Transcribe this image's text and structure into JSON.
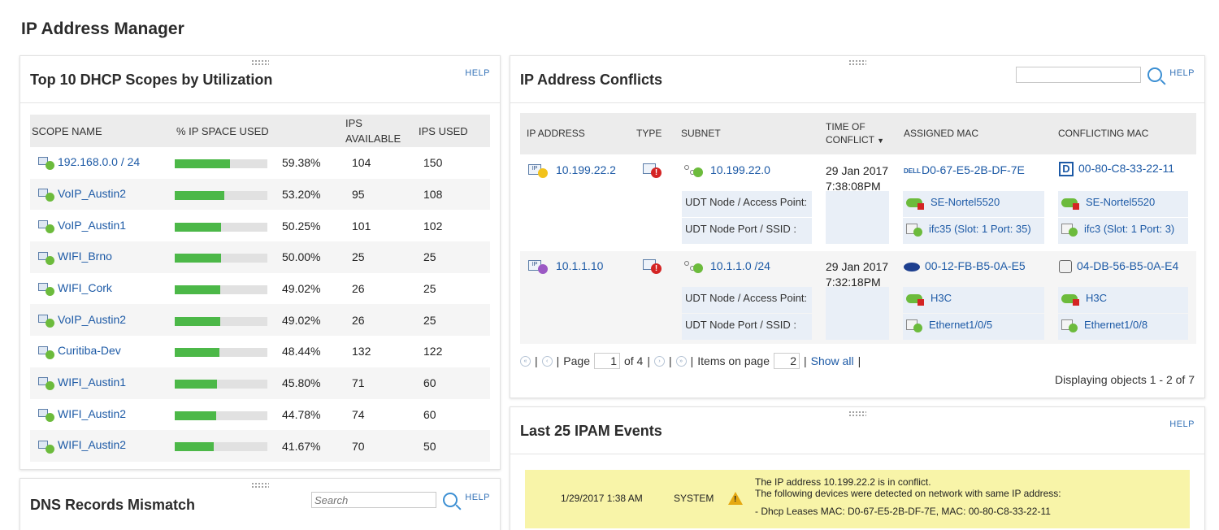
{
  "page_title": "IP Address Manager",
  "dhcp": {
    "title": "Top 10 DHCP Scopes by Utilization",
    "help": "HELP",
    "columns": {
      "scope": "SCOPE NAME",
      "used_pct": "% IP SPACE USED",
      "available": "IPS AVAILABLE",
      "used": "IPS USED"
    },
    "rows": [
      {
        "name": "192.168.0.0 / 24",
        "pct": "59.38%",
        "fill": 0.5938,
        "available": "104",
        "used": "150"
      },
      {
        "name": "VoIP_Austin2",
        "pct": "53.20%",
        "fill": 0.532,
        "available": "95",
        "used": "108"
      },
      {
        "name": "VoIP_Austin1",
        "pct": "50.25%",
        "fill": 0.5025,
        "available": "101",
        "used": "102"
      },
      {
        "name": "WIFI_Brno",
        "pct": "50.00%",
        "fill": 0.5,
        "available": "25",
        "used": "25"
      },
      {
        "name": "WIFI_Cork",
        "pct": "49.02%",
        "fill": 0.4902,
        "available": "26",
        "used": "25"
      },
      {
        "name": "VoIP_Austin2",
        "pct": "49.02%",
        "fill": 0.4902,
        "available": "26",
        "used": "25"
      },
      {
        "name": "Curitiba-Dev",
        "pct": "48.44%",
        "fill": 0.4844,
        "available": "132",
        "used": "122"
      },
      {
        "name": "WIFI_Austin1",
        "pct": "45.80%",
        "fill": 0.458,
        "available": "71",
        "used": "60"
      },
      {
        "name": "WIFI_Austin2",
        "pct": "44.78%",
        "fill": 0.4478,
        "available": "74",
        "used": "60"
      },
      {
        "name": "WIFI_Austin2",
        "pct": "41.67%",
        "fill": 0.4167,
        "available": "70",
        "used": "50"
      }
    ]
  },
  "dns": {
    "title": "DNS Records Mismatch",
    "search_placeholder": "Search",
    "help": "HELP"
  },
  "conflicts": {
    "title": "IP Address Conflicts",
    "help": "HELP",
    "columns": {
      "ip": "IP ADDRESS",
      "type": "TYPE",
      "subnet": "SUBNET",
      "time": "TIME OF CONFLICT",
      "assigned": "ASSIGNED MAC",
      "conflicting": "CONFLICTING MAC"
    },
    "label_access_point": "UDT Node / Access Point:",
    "label_port": "UDT Node Port / SSID :",
    "rows": [
      {
        "ip": "10.199.22.2",
        "ip_color": "#f2c21b",
        "subnet": "10.199.22.0",
        "date": "29 Jan 2017",
        "time": "7:38:08PM",
        "assigned_vendor": "DELL",
        "assigned_mac": "D0-67-E5-2B-DF-7E",
        "assigned_node": "SE-Nortel5520",
        "assigned_port": "ifc35 (Slot: 1 Port: 35)",
        "conflicting_mac": "00-80-C8-33-22-11",
        "conflicting_node": "SE-Nortel5520",
        "conflicting_port": "ifc3 (Slot: 1 Port: 3)"
      },
      {
        "ip": "10.1.1.10",
        "ip_color": "#9b59c4",
        "subnet": "10.1.1.0 /24",
        "date": "29 Jan 2017",
        "time": "7:32:18PM",
        "assigned_mac": "00-12-FB-B5-0A-E5",
        "assigned_node": "H3C",
        "assigned_port": "Ethernet1/0/5",
        "conflicting_mac": "04-DB-56-B5-0A-E4",
        "conflicting_node": "H3C",
        "conflicting_port": "Ethernet1/0/8"
      }
    ],
    "pager": {
      "page_label": "Page",
      "page": "1",
      "of": "of 4",
      "items_label": "Items on page",
      "items": "2",
      "show_all": "Show all"
    },
    "displaying": "Displaying objects 1 - 2 of 7"
  },
  "events": {
    "title": "Last 25 IPAM Events",
    "help": "HELP",
    "date": "1/29/2017 1:38 AM",
    "source": "SYSTEM",
    "line1": "The IP address 10.199.22.2 is in conflict.",
    "line2": "The following devices were detected on network with same IP address:",
    "line3": "- Dhcp Leases MAC: D0-67-E5-2B-DF-7E, MAC: 00-80-C8-33-22-11"
  }
}
